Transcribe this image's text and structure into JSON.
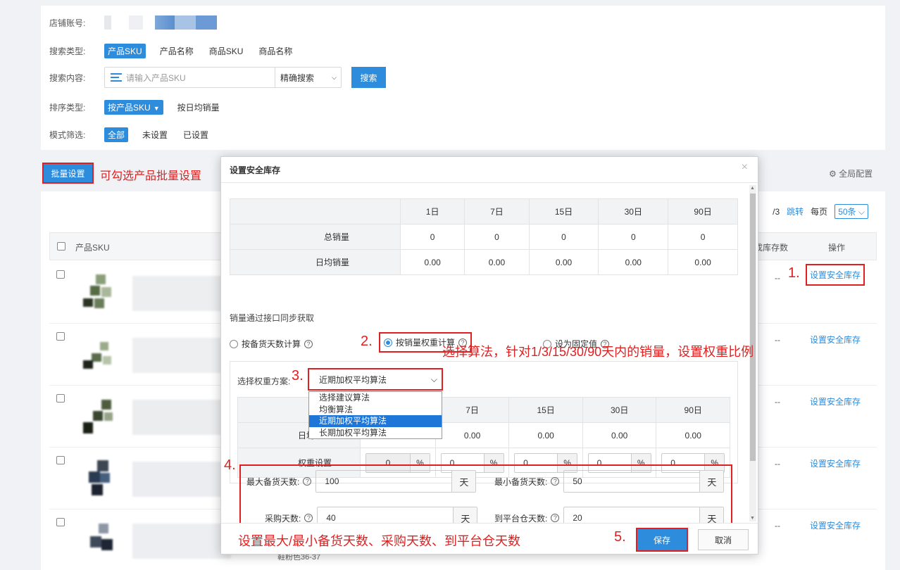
{
  "filters": {
    "store_label": "店铺账号:",
    "search_type_label": "搜索类型:",
    "search_types": [
      "产品SKU",
      "产品名称",
      "商品SKU",
      "商品名称"
    ],
    "search_content_label": "搜索内容:",
    "search_placeholder": "请输入产品SKU",
    "search_mode": "精确搜索",
    "search_button": "搜索",
    "sort_label": "排序类型:",
    "sort_primary": "按产品SKU",
    "sort_secondary": "按日均销量",
    "mode_label": "模式筛选:",
    "modes": [
      "全部",
      "未设置",
      "已设置"
    ]
  },
  "toolbar": {
    "batch_button": "批量设置",
    "batch_note": "可勾选产品批量设置",
    "global_config": "全局配置"
  },
  "pager": {
    "page_fragment": "/3",
    "jump": "跳转",
    "per_page_label": "每页",
    "per_page_value": "50条"
  },
  "table": {
    "col_sku": "产品SKU",
    "col_stock": "成库存数",
    "col_op": "操作",
    "rows": [
      {
        "dash": "--",
        "op": "设置安全库存"
      },
      {
        "dash": "--",
        "op": "设置安全库存"
      },
      {
        "dash": "--",
        "op": "设置安全库存"
      },
      {
        "dash": "--",
        "op": "设置安全库存"
      },
      {
        "dash": "--",
        "op": "设置安全库存"
      }
    ],
    "last_row_text": "鞋粉色36-37"
  },
  "modal": {
    "title": "设置安全库存",
    "sales_table": {
      "headers": [
        "",
        "1日",
        "7日",
        "15日",
        "30日",
        "90日"
      ],
      "rows": [
        {
          "label": "总销量",
          "values": [
            "0",
            "0",
            "0",
            "0",
            "0"
          ]
        },
        {
          "label": "日均销量",
          "values": [
            "0.00",
            "0.00",
            "0.00",
            "0.00",
            "0.00"
          ]
        }
      ]
    },
    "source_note": "销量通过接口同步获取",
    "radio_options": [
      "按备货天数计算",
      "按销量权重计算",
      "设为固定值"
    ],
    "weight_label": "选择权重方案:",
    "weight_selected": "近期加权平均算法",
    "weight_options": [
      "选择建议算法",
      "均衡算法",
      "近期加权平均算法",
      "长期加权平均算法"
    ],
    "weight_table": {
      "headers": [
        "7日",
        "15日",
        "30日",
        "90日"
      ],
      "daily_label": "日均销量",
      "daily_values": [
        "0.00",
        "0.00",
        "0.00",
        "0.00"
      ],
      "weight_row_label": "权重设置",
      "weights": [
        "0",
        "0",
        "0",
        "0",
        "0"
      ],
      "unit": "%"
    },
    "days": {
      "max_label": "最大备货天数:",
      "max_value": "100",
      "min_label": "最小备货天数:",
      "min_value": "50",
      "purchase_label": "采购天数:",
      "purchase_value": "40",
      "arrival_label": "到平台仓天数:",
      "arrival_value": "20",
      "unit": "天"
    },
    "save": "保存",
    "cancel": "取消"
  },
  "annotations": {
    "n1": "1.",
    "n2": "2.",
    "n3": "3.",
    "n3_text": "选择算法，针对1/3/15/30/90天内的销量，设置权重比例",
    "n4": "4.",
    "n5": "5.",
    "footer_text": "设置最大/最小备货天数、采购天数、到平台仓天数"
  },
  "colors": {
    "primary": "#2d8cdb",
    "annotation": "#e02020"
  }
}
